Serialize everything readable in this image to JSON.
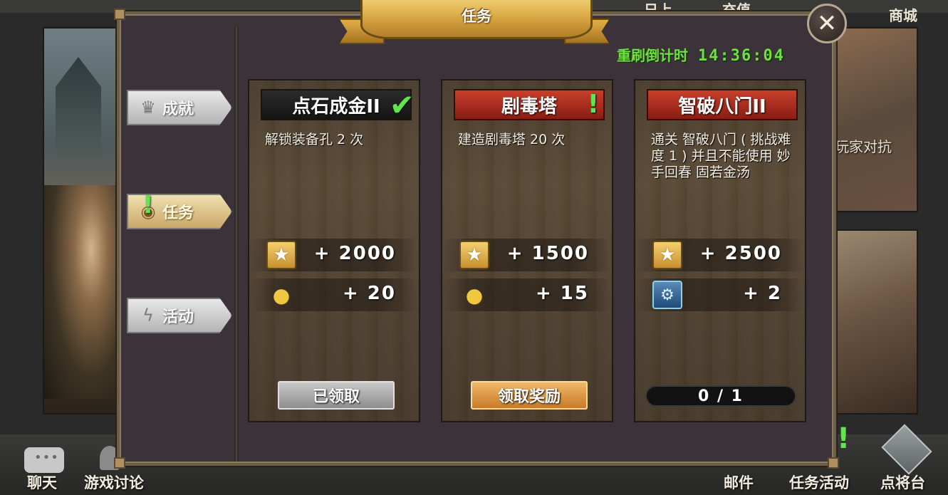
{
  "background": {
    "top_items": [
      "日上",
      "充值",
      "商城"
    ],
    "right_label": "玩家对抗",
    "bottom_items": [
      "聊天",
      "游戏讨论",
      "邮件",
      "任务活动",
      "点将台"
    ]
  },
  "dialog": {
    "title": "任务",
    "close_icon": "close-icon",
    "countdown_label": "重刷倒计时",
    "countdown_time": "14:36:04"
  },
  "tabs": [
    {
      "label": "成就",
      "icon": "crown-icon",
      "active": false
    },
    {
      "label": "任务",
      "icon": "eye-icon",
      "active": true,
      "badge": "!"
    },
    {
      "label": "活动",
      "icon": "lightning-icon",
      "active": false
    }
  ],
  "quests": [
    {
      "title": "点石成金II",
      "title_style": "black",
      "status_mark": "✔",
      "desc": "解锁装备孔 2 次",
      "rewards": [
        {
          "icon": "star-icon",
          "value": "+ 2000"
        },
        {
          "icon": "coin-icon",
          "value": "+ 20"
        }
      ],
      "button": "已领取"
    },
    {
      "title": "剧毒塔",
      "title_style": "red",
      "status_mark": "!",
      "desc": "建造剧毒塔 20 次",
      "rewards": [
        {
          "icon": "star-icon",
          "value": "+ 1500"
        },
        {
          "icon": "coin-icon",
          "value": "+ 15"
        }
      ],
      "button": "领取奖励"
    },
    {
      "title": "智破八门II",
      "title_style": "red",
      "desc": "通关 智破八门 ( 挑战难度 1 ) 并且不能使用 妙手回春 固若金汤",
      "rewards": [
        {
          "icon": "star-icon",
          "value": "+ 2500"
        },
        {
          "icon": "rune-icon",
          "value": "+ 2"
        }
      ],
      "progress": "0 / 1"
    }
  ],
  "colors": {
    "accent_green": "#5fe64a",
    "button_orange": "#e09a48",
    "title_red": "#b0301e"
  }
}
